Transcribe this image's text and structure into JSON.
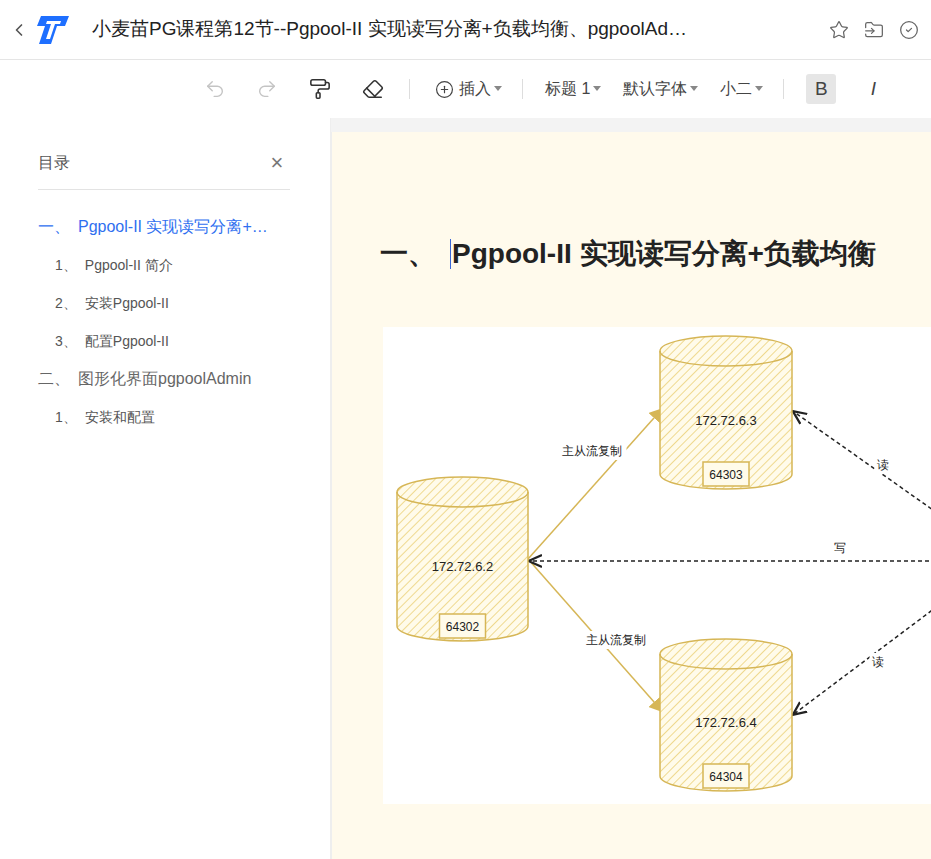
{
  "window": {
    "title": "小麦苗PG课程第12节--Pgpool-II 实现读写分离+负载均衡、pgpoolAd…"
  },
  "toolbar": {
    "undo": {
      "disabled": true
    },
    "redo": {
      "disabled": true
    },
    "insert": "插入",
    "heading": "标题 1",
    "font": "默认字体",
    "size": "小二",
    "bold": {
      "label": "B",
      "selected": true
    },
    "italic": {
      "label": "I",
      "selected": false
    }
  },
  "outline": {
    "title": "目录",
    "close": "×",
    "items": [
      {
        "number": "一、",
        "text": "Pgpool-II 实现读写分离+…",
        "level": 1,
        "selected": true
      },
      {
        "number": "1、",
        "text": "Pgpool-II 简介",
        "level": 2,
        "selected": false
      },
      {
        "number": "2、",
        "text": "安装Pgpool-II",
        "level": 2,
        "selected": false
      },
      {
        "number": "3、",
        "text": "配置Pgpool-II",
        "level": 2,
        "selected": false
      },
      {
        "number": "二、",
        "text": "图形化界面pgpoolAdmin",
        "level": 1,
        "selected": false
      },
      {
        "number": "1、",
        "text": "安装和配置",
        "level": 2,
        "selected": false
      }
    ]
  },
  "document": {
    "heading": {
      "number": "一、",
      "text": "Pgpool-II 实现读写分离+负载均衡"
    }
  },
  "diagram": {
    "nodes": [
      {
        "ip": "172.72.6.2",
        "port": "64302"
      },
      {
        "ip": "172.72.6.3",
        "port": "64303"
      },
      {
        "ip": "172.72.6.4",
        "port": "64304"
      }
    ],
    "edges": [
      {
        "label": "主从流复制",
        "kind": "replication"
      },
      {
        "label": "主从流复制",
        "kind": "replication"
      },
      {
        "label": "读",
        "kind": "query"
      },
      {
        "label": "写",
        "kind": "query"
      },
      {
        "label": "读",
        "kind": "query"
      }
    ]
  }
}
